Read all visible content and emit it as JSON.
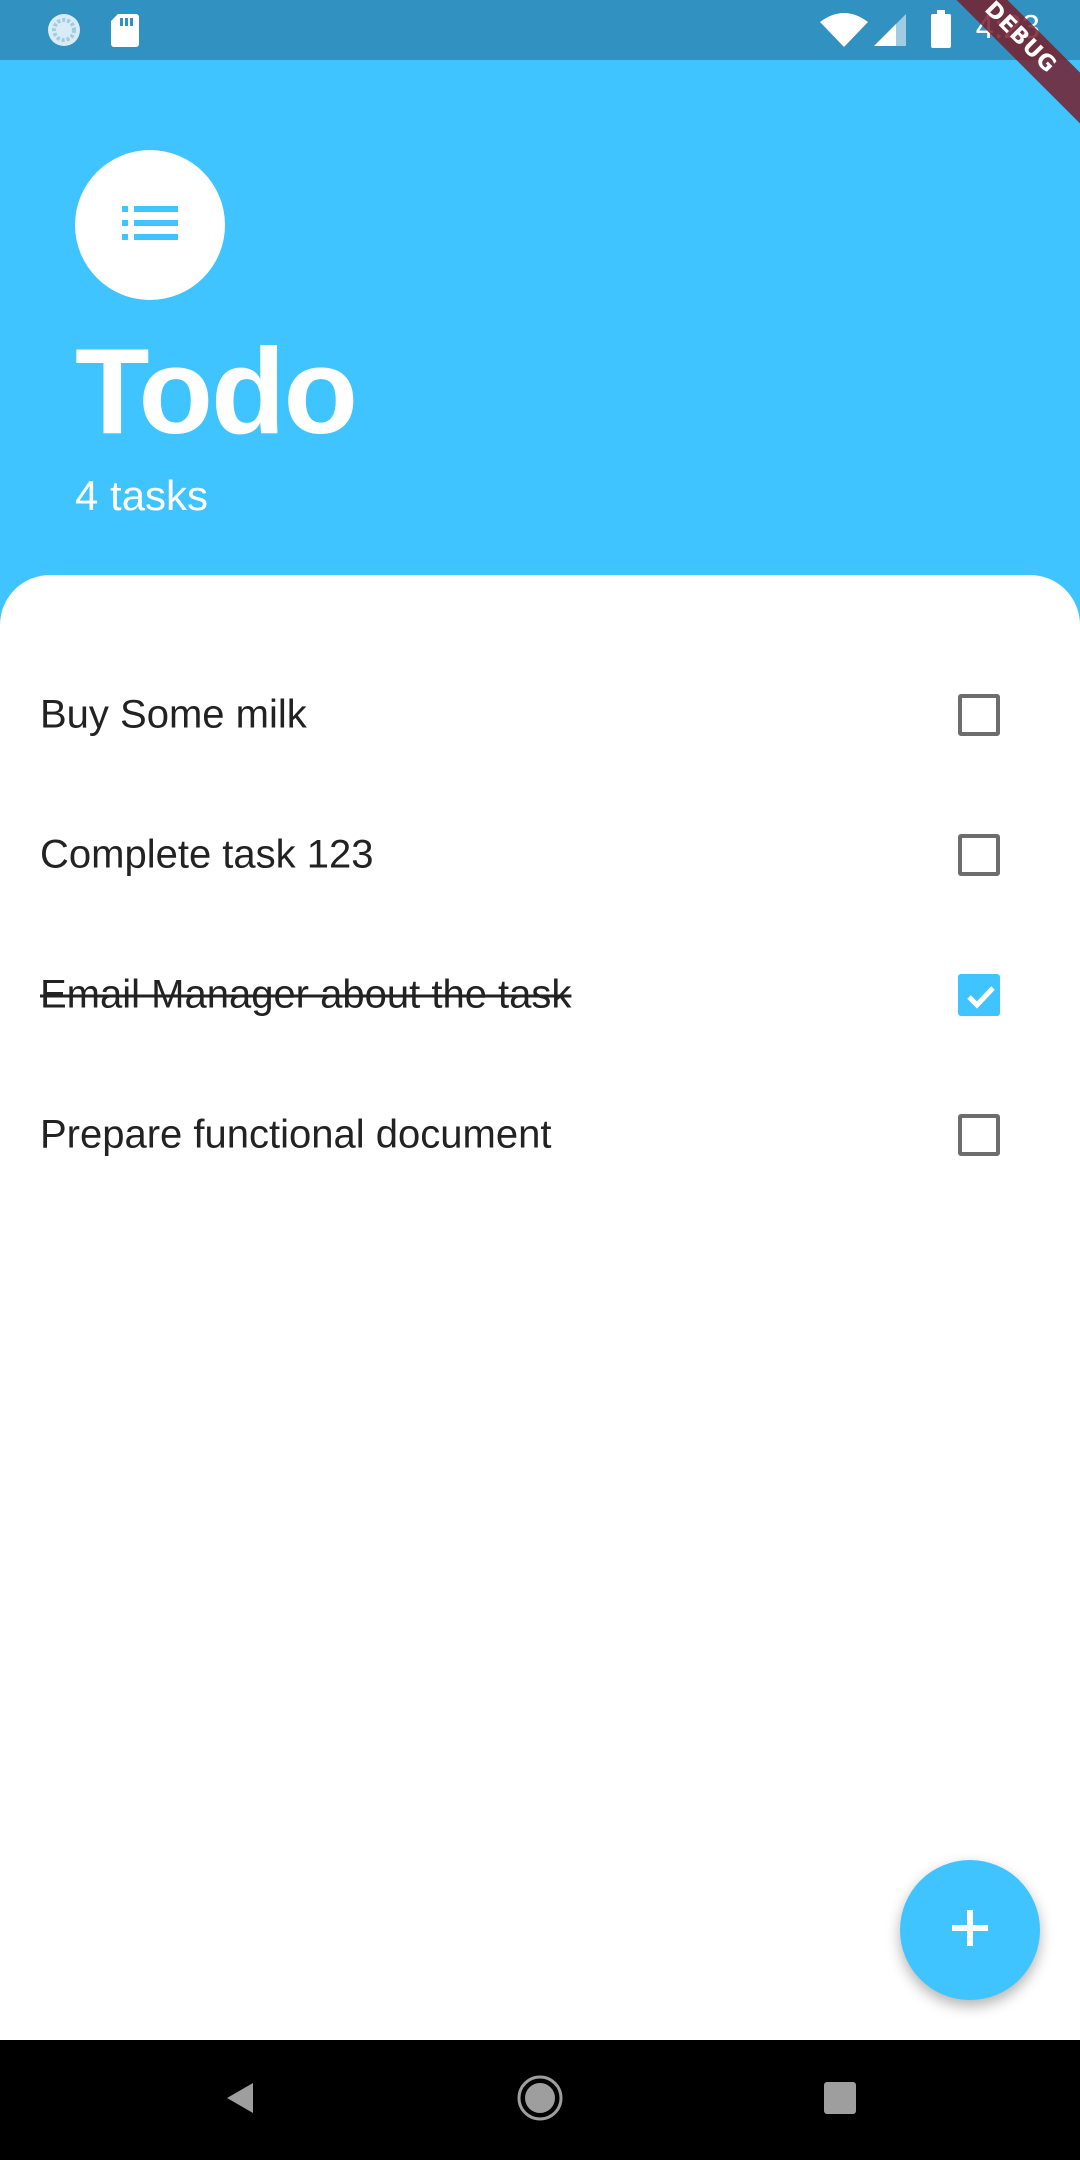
{
  "status_bar": {
    "time": "4:23",
    "debug_label": "DEBUG"
  },
  "header": {
    "title": "Todo",
    "task_count": "4 tasks",
    "avatar_icon": "list-icon"
  },
  "tasks": [
    {
      "label": "Buy Some milk",
      "done": false
    },
    {
      "label": "Complete task 123",
      "done": false
    },
    {
      "label": "Email Manager about the task",
      "done": true
    },
    {
      "label": "Prepare functional document",
      "done": false
    }
  ],
  "fab": {
    "icon": "plus-icon"
  },
  "nav_bar": {
    "back_icon": "back-icon",
    "home_icon": "home-icon",
    "recents_icon": "recents-icon"
  },
  "colors": {
    "accent": "#40c4ff",
    "status_bar": "#3192c2",
    "text": "#222222",
    "checkbox_border": "#6d6d6d"
  }
}
